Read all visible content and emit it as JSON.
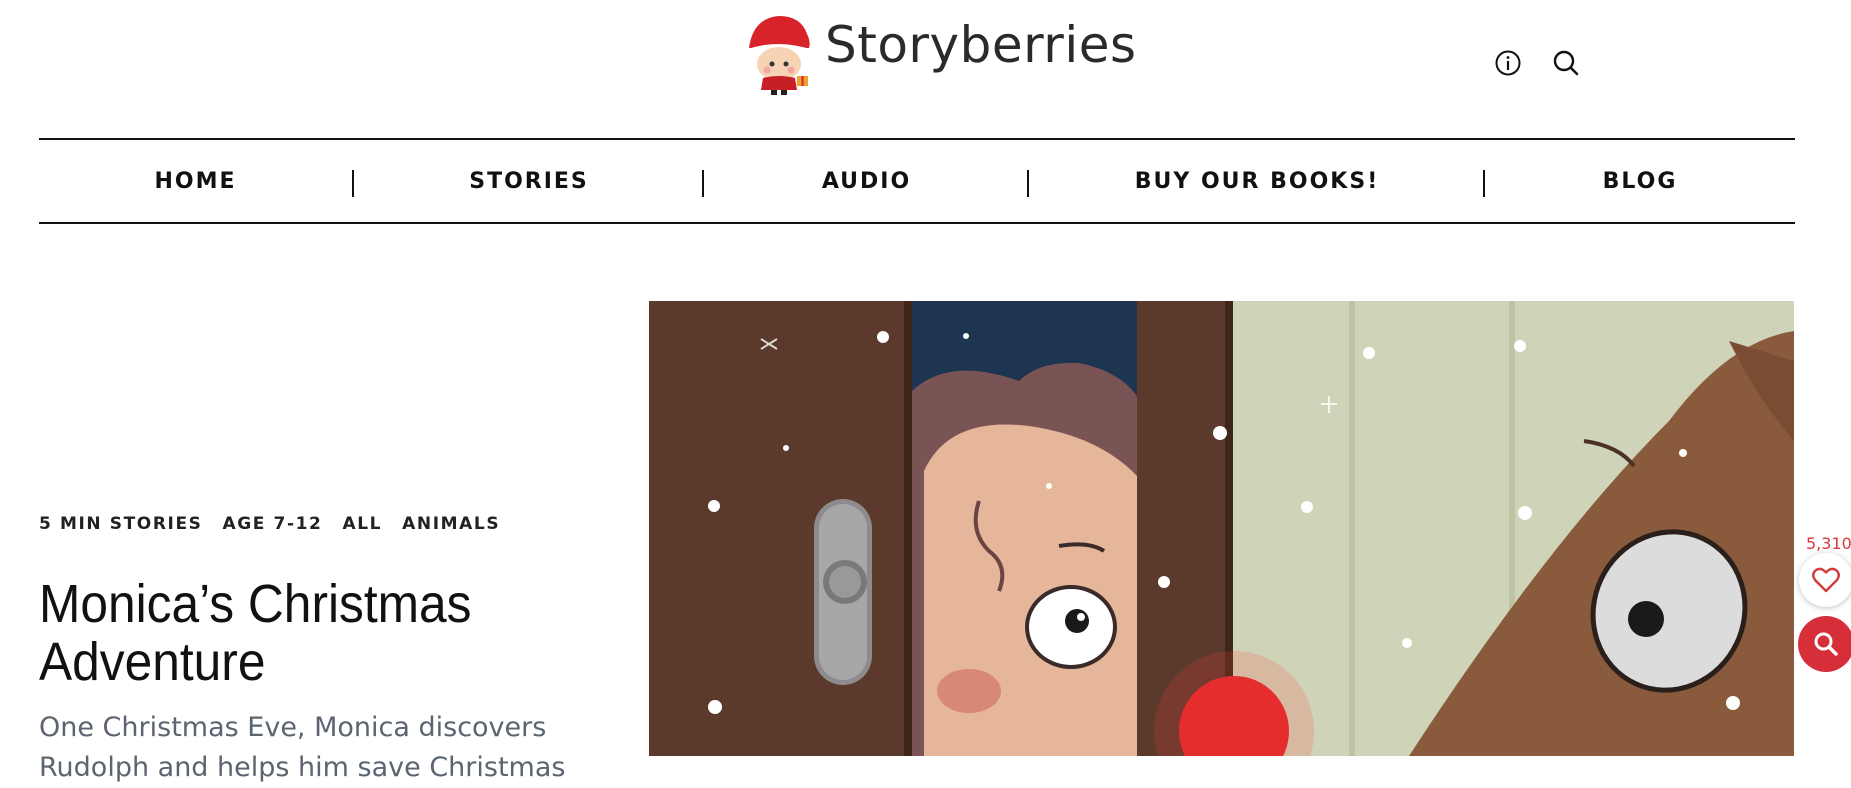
{
  "brand": {
    "name": "Storyberries"
  },
  "header": {
    "icons": [
      "info-icon",
      "search-icon"
    ]
  },
  "nav": {
    "items": [
      "HOME",
      "STORIES",
      "AUDIO",
      "BUY OUR BOOKS!",
      "BLOG"
    ]
  },
  "post": {
    "tags": [
      "5 MIN STORIES",
      "AGE 7-12",
      "ALL",
      "ANIMALS"
    ],
    "title": "Monica’s Christmas Adventure",
    "excerpt": "One Christmas Eve, Monica discovers Rudolph and helps him save Christmas"
  },
  "likes": {
    "count": "5,310"
  },
  "colors": {
    "accent": "#d62f3a",
    "text": "#111111",
    "muted": "#5b6470",
    "reindeer": "#8a5a3c",
    "door": "#5c3b2a"
  }
}
